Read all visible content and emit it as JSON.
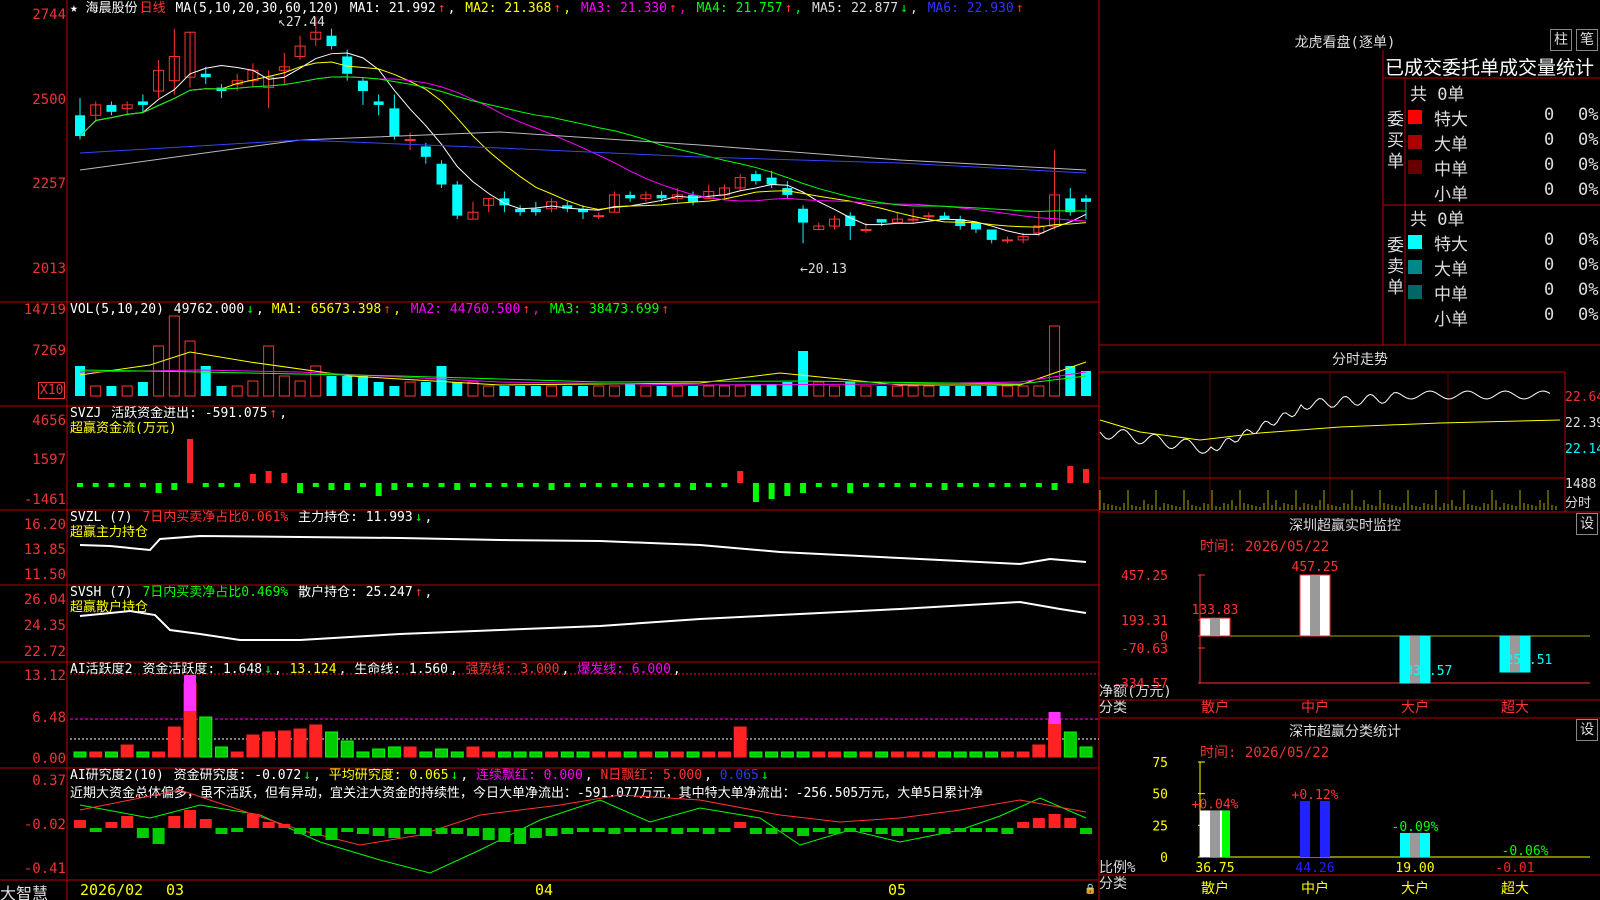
{
  "main": {
    "stock_label": "★ 海晨股份",
    "period": "日线",
    "ma_params": "MA(5,10,20,30,60,120)",
    "ma": [
      {
        "label": "MA1: 21.992",
        "arrow": "↑",
        "color": "#ffffff"
      },
      {
        "label": "MA2: 21.368",
        "arrow": "↑",
        "color": "#ffff00"
      },
      {
        "label": "MA3: 21.330",
        "arrow": "↑",
        "color": "#ff00ff"
      },
      {
        "label": "MA4: 21.757",
        "arrow": "↑",
        "color": "#00ff00"
      },
      {
        "label": "MA5: 22.877",
        "arrow": "↓",
        "color": "#dddddd"
      },
      {
        "label": "MA6: 22.930",
        "arrow": "↑",
        "color": "#3333ff"
      }
    ],
    "yticks": [
      "2744",
      "2500",
      "2257",
      "2013"
    ],
    "high_mark": "27.44",
    "low_mark": "←20.13"
  },
  "vol": {
    "params": "VOL(5,10,20)",
    "value": "49762.000",
    "arrow": "↓",
    "ma": [
      {
        "label": "MA1: 65673.398",
        "arrow": "↑",
        "color": "#ffff00"
      },
      {
        "label": "MA2: 44760.500",
        "arrow": "↑",
        "color": "#ff00ff"
      },
      {
        "label": "MA3: 38473.699",
        "arrow": "↑",
        "color": "#00ff00"
      }
    ],
    "yticks": [
      "14719",
      "7269"
    ],
    "unit": "X10"
  },
  "svzj": {
    "name": "SVZJ",
    "label": "活跃资金进出: -591.075",
    "arrow": "↑",
    "sub": "超赢资金流(万元)",
    "yticks": [
      "4656",
      "1597",
      "-1461"
    ]
  },
  "svzl": {
    "name": "SVZL (7)",
    "pct": "7日内买卖净占比0.061%",
    "hold": "主力持仓: 11.993",
    "arrow": "↓",
    "sub": "超赢主力持仓",
    "yticks": [
      "16.20",
      "13.85",
      "11.50"
    ]
  },
  "svsh": {
    "name": "SVSH (7)",
    "pct": "7日内买卖净占比0.469%",
    "hold": "散户持仓: 25.247",
    "arrow": "↑",
    "sub": "超赢散户持仓",
    "yticks": [
      "26.04",
      "24.35",
      "22.72"
    ]
  },
  "ai1": {
    "name": "AI活跃度2",
    "active": "资金活跃度: 1.648",
    "arrow": "↓",
    "v2": "13.124",
    "life": "生命线: 1.560",
    "strong": "强势线: 3.000",
    "burst": "爆发线: 6.000",
    "yticks": [
      "13.12",
      "6.48",
      "0.00"
    ]
  },
  "ai2": {
    "name": "AI研究度2(10)",
    "r1": "资金研究度: -0.072",
    "arrow1": "↓",
    "r2": "平均研究度: 0.065",
    "arrow2": "↓",
    "r3": "连续飘红: 0.000",
    "r4": "N日飘红: 5.000",
    "r5": "0.065",
    "arrow5": "↓",
    "comment": "近期大资金总体偏多，虽不活跃，但有异动，宜关注大资金的持续性，今日大单净流出：-591.077万元，其中特大单净流出：-256.505万元，大单5日累计净",
    "yticks": [
      "0.37",
      "-0.02",
      "-0.41"
    ]
  },
  "xaxis": {
    "brand": "大智慧",
    "labels": [
      "2026/02",
      "03",
      "04",
      "05"
    ]
  },
  "lhb": {
    "title": "龙虎看盘(逐单)",
    "btn1": "柱",
    "btn2": "笔",
    "subtitle": "已成交委托单成交量统计",
    "buy_side": "委买单",
    "sell_side": "委卖单",
    "buy_total": "共 0单",
    "sell_total": "共 0单",
    "buy_rows": [
      {
        "label": "特大",
        "count": "0",
        "pct": "0%",
        "color": "#ff0000"
      },
      {
        "label": "大单",
        "count": "0",
        "pct": "0%",
        "color": "#aa0000"
      },
      {
        "label": "中单",
        "count": "0",
        "pct": "0%",
        "color": "#660000"
      },
      {
        "label": "小单",
        "count": "0",
        "pct": "0%",
        "color": "#000000"
      }
    ],
    "sell_rows": [
      {
        "label": "特大",
        "count": "0",
        "pct": "0%",
        "color": "#00ffff"
      },
      {
        "label": "大单",
        "count": "0",
        "pct": "0%",
        "color": "#008888"
      },
      {
        "label": "中单",
        "count": "0",
        "pct": "0%",
        "color": "#006666"
      },
      {
        "label": "小单",
        "count": "0",
        "pct": "0%",
        "color": "#000000"
      }
    ]
  },
  "fenshi": {
    "title": "分时走势",
    "yticks": [
      "22.64",
      "22.39",
      "22.14"
    ],
    "vol_tick": "1488",
    "unit": "分时"
  },
  "sz_monitor": {
    "title": "深圳超赢实时监控",
    "btn": "设",
    "time": "时间: 2026/05/22",
    "yticks": [
      "457.25",
      "193.31",
      "0",
      "-70.63",
      "-334.57"
    ],
    "ylabel": "净额(万元)",
    "xlabel": "分类",
    "cats": [
      "散户",
      "中户",
      "大户",
      "超大"
    ],
    "values": [
      133.83,
      457.25,
      -334.57,
      -256.51
    ],
    "value_labels": [
      "133.83",
      "457.25",
      "-334.57",
      "-256.51"
    ]
  },
  "sz_class": {
    "title": "深市超赢分类统计",
    "btn": "设",
    "time": "时间: 2026/05/22",
    "yticks": [
      "75",
      "50",
      "25",
      "0"
    ],
    "ylabel": "比例%",
    "xlabel": "分类",
    "cats": [
      "散户",
      "中户",
      "大户",
      "超大"
    ],
    "values": [
      36.75,
      44.26,
      19.0,
      0.01
    ],
    "value_labels": [
      "36.75",
      "44.26",
      "19.00",
      "-0.01"
    ],
    "changes": [
      "+0.04%",
      "+0.12%",
      "-0.09%",
      "-0.06%"
    ]
  }
}
